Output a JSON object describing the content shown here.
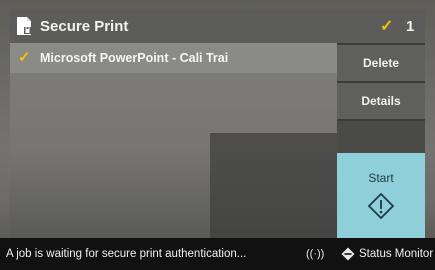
{
  "header": {
    "title": "Secure Print",
    "icon": "secure-document-icon",
    "selected_mark": "✓",
    "selected_count": "1"
  },
  "jobs": [
    {
      "checked": "✓",
      "name": "Microsoft PowerPoint - Cali Trai"
    }
  ],
  "side_buttons": {
    "delete": "Delete",
    "details": "Details"
  },
  "start": {
    "label": "Start",
    "icon": "start-diamond-icon"
  },
  "status_bar": {
    "message": "A job is waiting for secure print authentication...",
    "signal_icon": "wireless-signal-icon",
    "signal_glyph": "((·))",
    "monitor_label": "Status Monitor",
    "monitor_icon": "status-monitor-icon"
  },
  "colors": {
    "accent_check": "#f2c200",
    "start_button": "#8fcfd9",
    "header": "#5c5c5a",
    "status_bar": "#111111"
  }
}
